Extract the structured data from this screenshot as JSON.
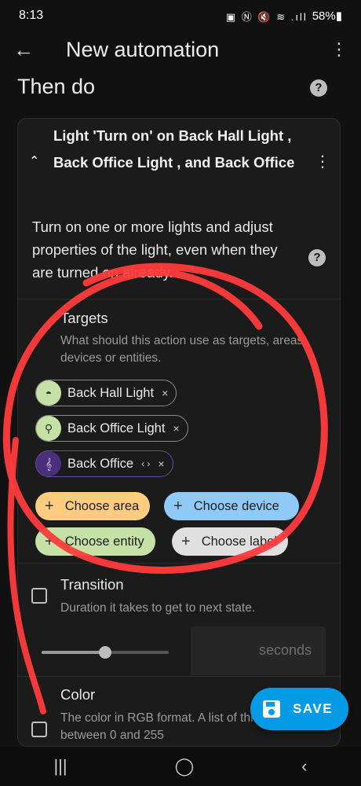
{
  "status_bar": {
    "time": "8:13",
    "icons": "▣ Ⓝ 🔇 ≋ .ıll",
    "battery": "58%▮"
  },
  "app_bar": {
    "back_icon": "←",
    "title": "New automation",
    "menu_icon": "⋮"
  },
  "section": {
    "title": "Then do",
    "help_icon": "?"
  },
  "action_card": {
    "collapse_icon": "⌃",
    "title": "Light 'Turn on' on Back Hall Light , Back Office Light , and Back Office",
    "menu_icon": "⋮",
    "description": "Turn on one or more lights and adjust properties of the light, even when they are turned on already.",
    "help_icon": "?"
  },
  "targets": {
    "title": "Targets",
    "description": "What should this action use as targets, areas, devices or entities.",
    "chips": [
      {
        "label": "Back Hall Light",
        "icon": "◓",
        "remove_icon": "×",
        "color": "#c5e1a5"
      },
      {
        "label": "Back Office Light",
        "icon": "⚲",
        "remove_icon": "×",
        "color": "#c5e1a5"
      },
      {
        "label": "Back Office",
        "icon": "𝄞",
        "expand_icon": "‹ ›",
        "remove_icon": "×",
        "color": "#4a2f7a"
      }
    ],
    "choose_buttons": [
      {
        "label": "Choose area",
        "color": "#ffcc80"
      },
      {
        "label": "Choose device",
        "color": "#90caf9"
      },
      {
        "label": "Choose entity",
        "color": "#c5e1a5"
      },
      {
        "label": "Choose label",
        "color": "#e0e0e0"
      }
    ],
    "plus_icon": "+"
  },
  "transition": {
    "title": "Transition",
    "description": "Duration it takes to get to next state.",
    "slider_value": 0.5,
    "unit_placeholder": "seconds"
  },
  "color": {
    "title": "Color",
    "description": "The color in RGB format. A list of three integers between 0 and 255"
  },
  "save_button": {
    "label": "SAVE",
    "color": "#039be5"
  },
  "nav_bar": {
    "recents": "|||",
    "home": "◯",
    "back": "‹"
  }
}
